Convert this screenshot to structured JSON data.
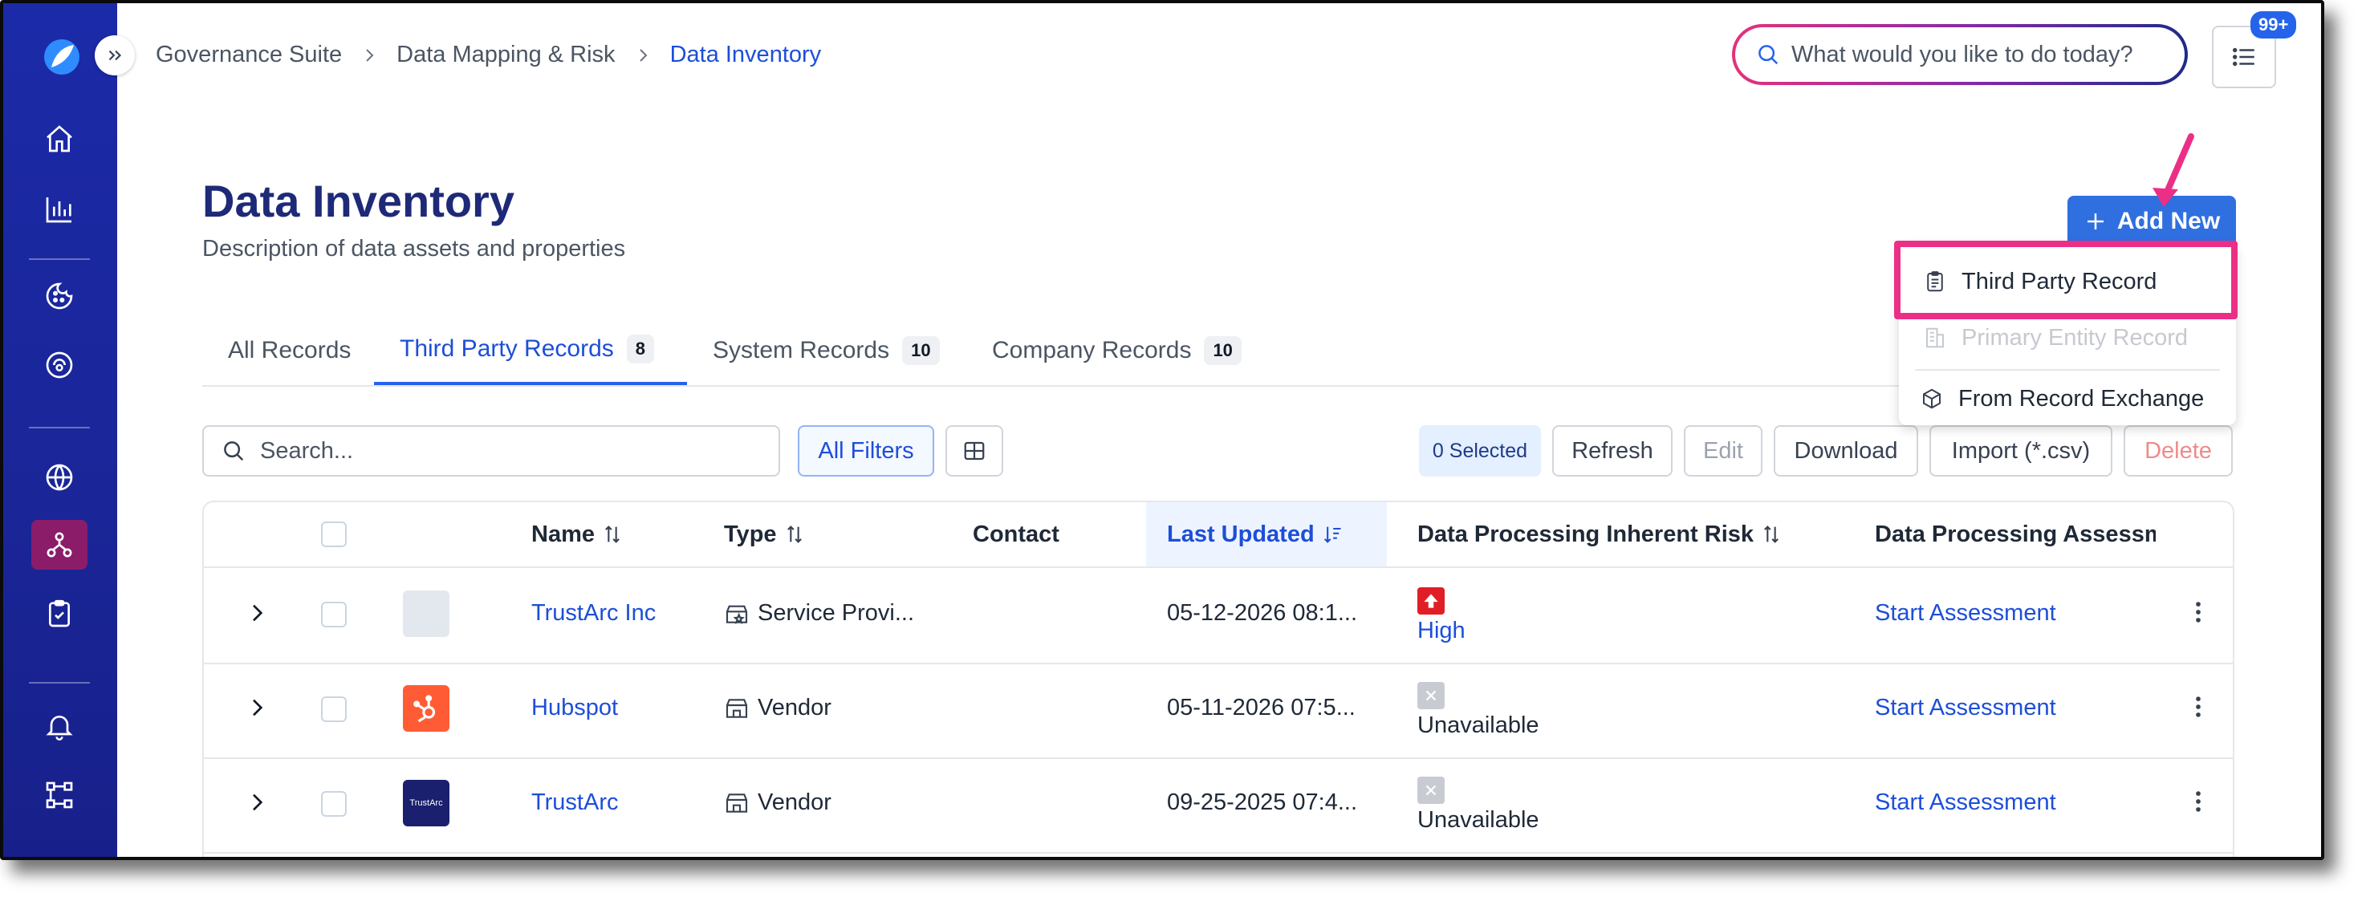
{
  "breadcrumb": {
    "items": [
      "Governance Suite",
      "Data Mapping & Risk",
      "Data Inventory"
    ]
  },
  "topbar": {
    "search_placeholder": "What would you like to do today?",
    "notification_badge": "99+"
  },
  "page": {
    "title": "Data Inventory",
    "description": "Description of data assets and properties",
    "add_new_label": "Add New"
  },
  "add_menu": {
    "items": [
      "Third Party Record",
      "Primary Entity Record",
      "From Record Exchange"
    ]
  },
  "tabs": [
    {
      "label": "All Records",
      "count": ""
    },
    {
      "label": "Third Party Records",
      "count": "8"
    },
    {
      "label": "System Records",
      "count": "10"
    },
    {
      "label": "Company Records",
      "count": "10"
    }
  ],
  "toolbar": {
    "search_placeholder": "Search...",
    "all_filters": "All Filters",
    "selected": "0 Selected",
    "refresh": "Refresh",
    "edit": "Edit",
    "download": "Download",
    "import": "Import (*.csv)",
    "delete": "Delete"
  },
  "table": {
    "columns": [
      "Name",
      "Type",
      "Contact",
      "Last Updated",
      "Data Processing Inherent Risk",
      "Data Processing Assessm"
    ],
    "rows": [
      {
        "name": "TrustArc Inc",
        "type": "Service Provi...",
        "contact": "",
        "updated": "05-12-2026 08:1...",
        "risk": "High",
        "assessment": "Start Assessment",
        "logo": "",
        "logo_color": "#e3e8ef"
      },
      {
        "name": "Hubspot",
        "type": "Vendor",
        "contact": "",
        "updated": "05-11-2026 07:5...",
        "risk": "Unavailable",
        "assessment": "Start Assessment",
        "logo": "hubspot-logo",
        "logo_color": "#ff5c35"
      },
      {
        "name": "TrustArc",
        "type": "Vendor",
        "contact": "",
        "updated": "09-25-2025 07:4...",
        "risk": "Unavailable",
        "assessment": "Start Assessment",
        "logo": "TrustArc",
        "logo_color": "#1a1f6e"
      }
    ]
  },
  "colors": {
    "sidebar": "#1b2aa8",
    "accent": "#2563eb",
    "highlight": "#ec2f86",
    "risk_high": "#e11d26"
  }
}
